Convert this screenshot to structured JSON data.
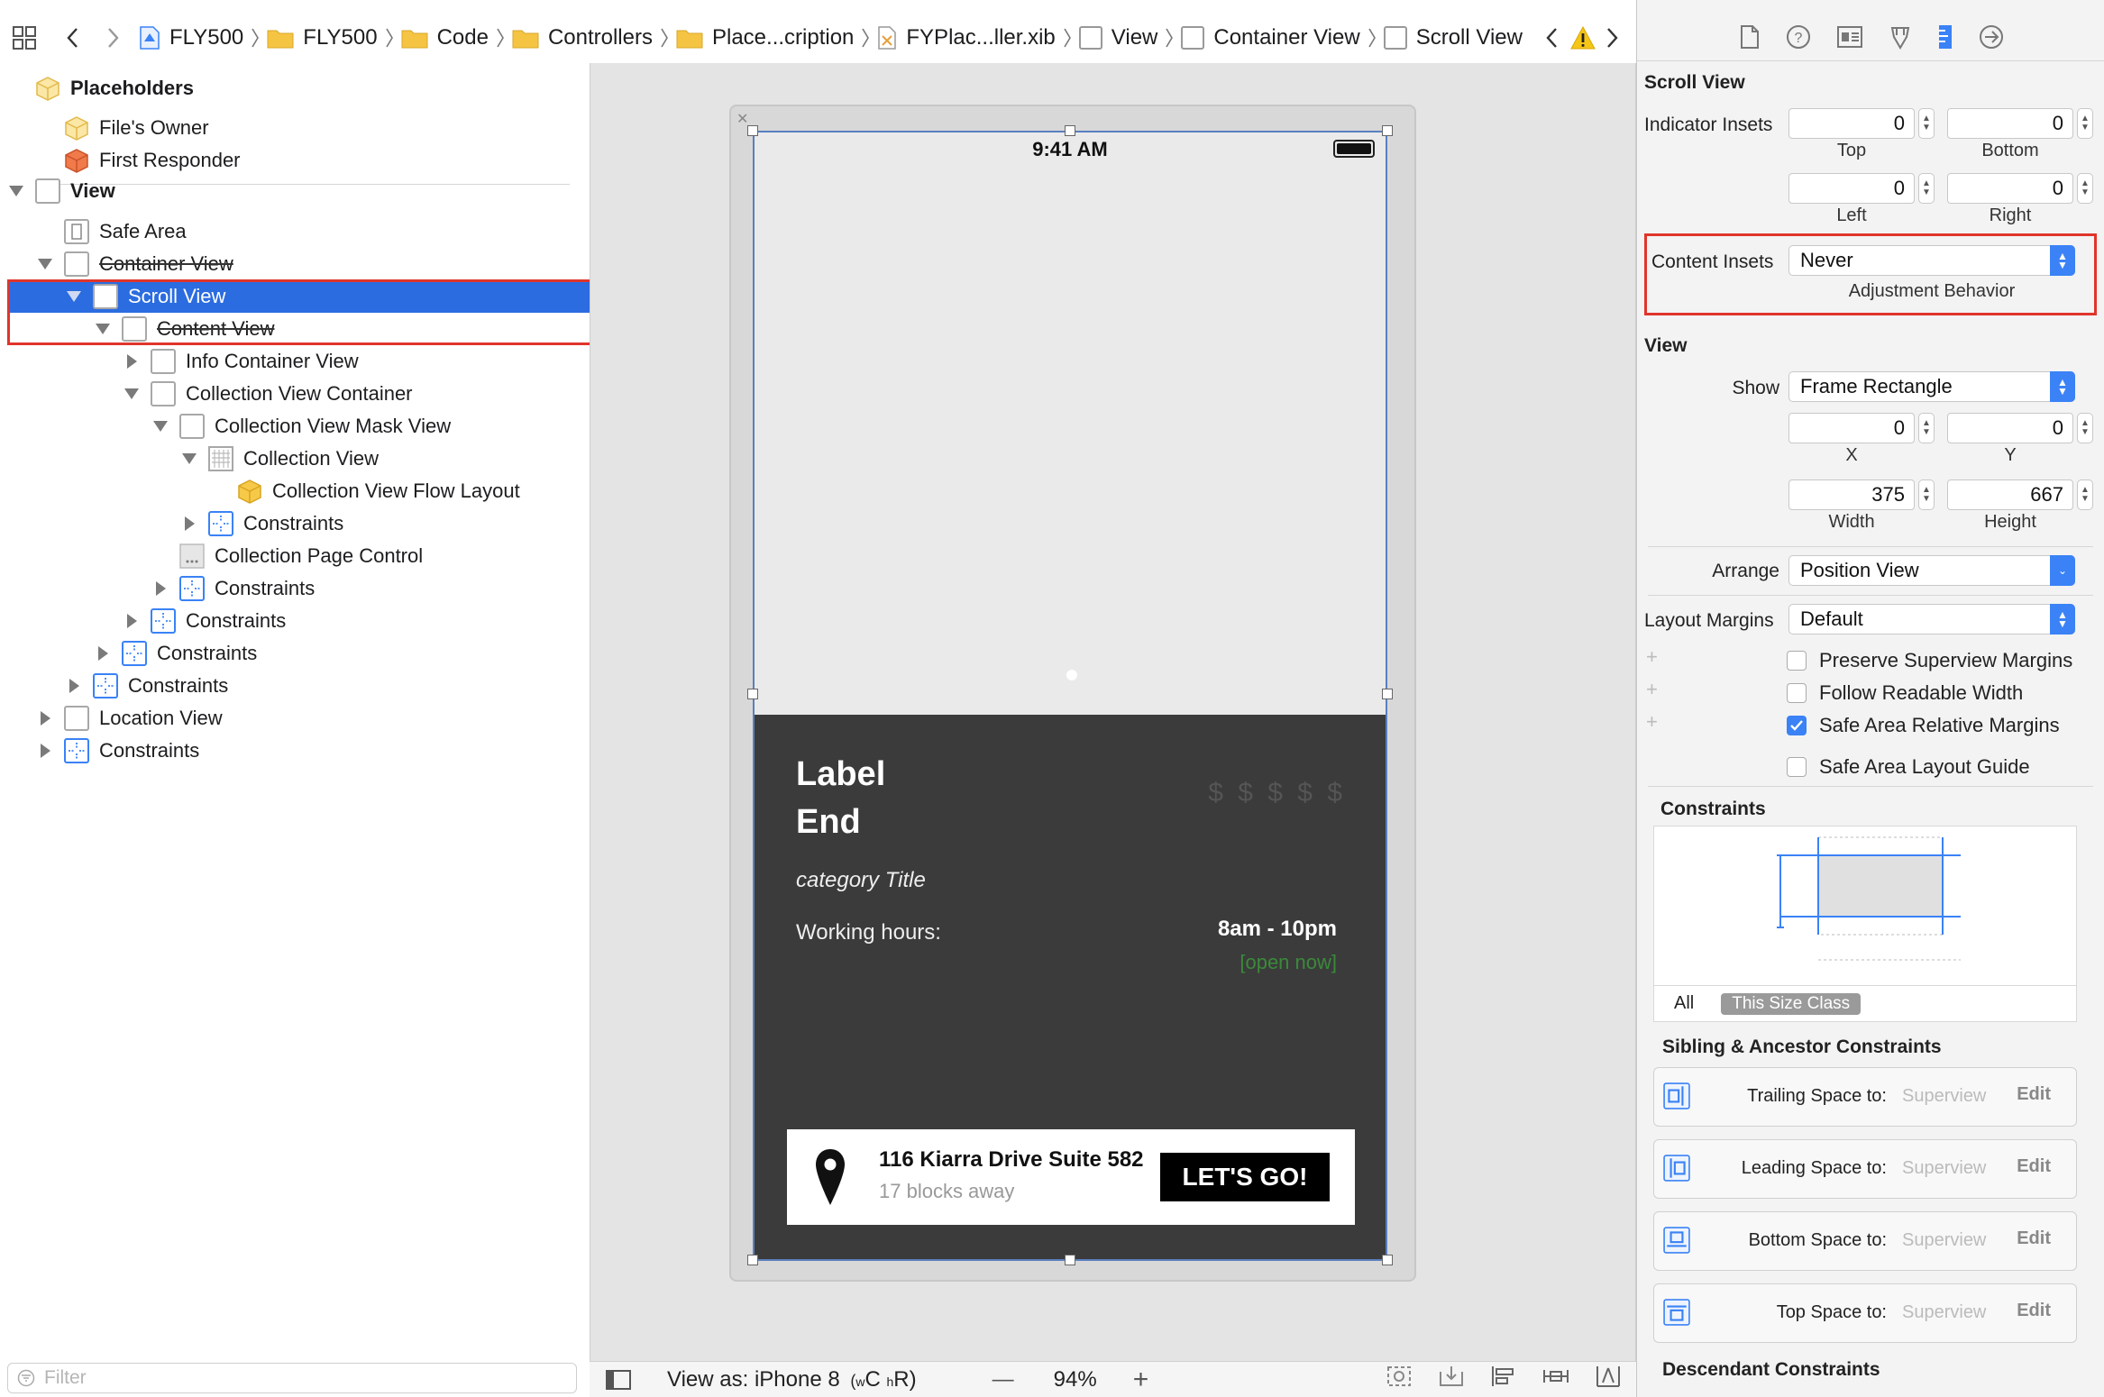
{
  "jumpbar": {
    "crumbs": [
      {
        "label": "FLY500",
        "icon": "project-file-icon"
      },
      {
        "label": "FLY500",
        "icon": "folder-icon"
      },
      {
        "label": "Code",
        "icon": "folder-icon"
      },
      {
        "label": "Controllers",
        "icon": "folder-icon"
      },
      {
        "label": "Place...cription",
        "icon": "folder-icon"
      },
      {
        "label": "FYPlac...ller.xib",
        "icon": "xib-file-icon"
      },
      {
        "label": "View",
        "icon": "view-icon"
      },
      {
        "label": "Container View",
        "icon": "view-icon"
      },
      {
        "label": "Scroll View",
        "icon": "view-icon"
      }
    ]
  },
  "outline": {
    "placeholders_label": "Placeholders",
    "files_owner": "File's Owner",
    "first_responder": "First Responder",
    "view": "View",
    "safe_area": "Safe Area",
    "container_view": "Container View",
    "scroll_view": "Scroll View",
    "content_view": "Content View",
    "info_container_view": "Info Container View",
    "collection_view_container": "Collection View Container",
    "collection_view_mask_view": "Collection View Mask View",
    "collection_view": "Collection View",
    "collection_view_flow_layout": "Collection View Flow Layout",
    "constraints": "Constraints",
    "collection_page_control": "Collection Page Control",
    "location_view": "Location View",
    "filter_placeholder": "Filter"
  },
  "phone": {
    "status_time": "9:41 AM",
    "label_line1": "Label",
    "label_line2": "End",
    "price_level": "$ $ $ $ $",
    "category_title": "category Title",
    "hours_label": "Working hours:",
    "hours_value": "8am - 10pm",
    "open_status": "[open now]",
    "address": "116 Kiarra Drive Suite 582",
    "distance": "17 blocks away",
    "go_button": "LET'S GO!"
  },
  "canvas_bar": {
    "view_as": "View as: iPhone 8",
    "size_class_w": "w",
    "size_class_wv": "C",
    "size_class_h": "h",
    "size_class_hv": "R",
    "zoom_minus": "—",
    "zoom": "94%",
    "zoom_plus": "+"
  },
  "inspector": {
    "scroll_view_title": "Scroll View",
    "indicator_insets_label": "Indicator Insets",
    "indicator_top": "0",
    "indicator_bottom": "0",
    "indicator_left": "0",
    "indicator_right": "0",
    "top_label": "Top",
    "bottom_label": "Bottom",
    "left_label": "Left",
    "right_label": "Right",
    "content_insets_label": "Content Insets",
    "content_insets_value": "Never",
    "adjustment_behavior": "Adjustment Behavior",
    "view_title": "View",
    "show_label": "Show",
    "show_value": "Frame Rectangle",
    "x_value": "0",
    "y_value": "0",
    "x_label": "X",
    "y_label": "Y",
    "width_value": "375",
    "height_value": "667",
    "width_label": "Width",
    "height_label": "Height",
    "arrange_label": "Arrange",
    "arrange_value": "Position View",
    "layout_margins_label": "Layout Margins",
    "layout_margins_value": "Default",
    "checks": [
      {
        "label": "Preserve Superview Margins",
        "checked": false
      },
      {
        "label": "Follow Readable Width",
        "checked": false
      },
      {
        "label": "Safe Area Relative Margins",
        "checked": true
      },
      {
        "label": "Safe Area Layout Guide",
        "checked": false
      }
    ],
    "constraints_title": "Constraints",
    "all_label": "All",
    "this_size_class": "This Size Class",
    "sibling_title": "Sibling & Ancestor Constraints",
    "sibling_constraints": [
      {
        "label": "Trailing Space to:",
        "target": "Superview",
        "action": "Edit"
      },
      {
        "label": "Leading Space to:",
        "target": "Superview",
        "action": "Edit"
      },
      {
        "label": "Bottom Space to:",
        "target": "Superview",
        "action": "Edit"
      },
      {
        "label": "Top Space to:",
        "target": "Superview",
        "action": "Edit"
      }
    ],
    "descendant_title": "Descendant Constraints"
  },
  "colors": {
    "selection": "#2b6ce0",
    "accent": "#3a82f6",
    "highlight_outline": "#e0352b",
    "open_status": "#3b8a3b"
  }
}
